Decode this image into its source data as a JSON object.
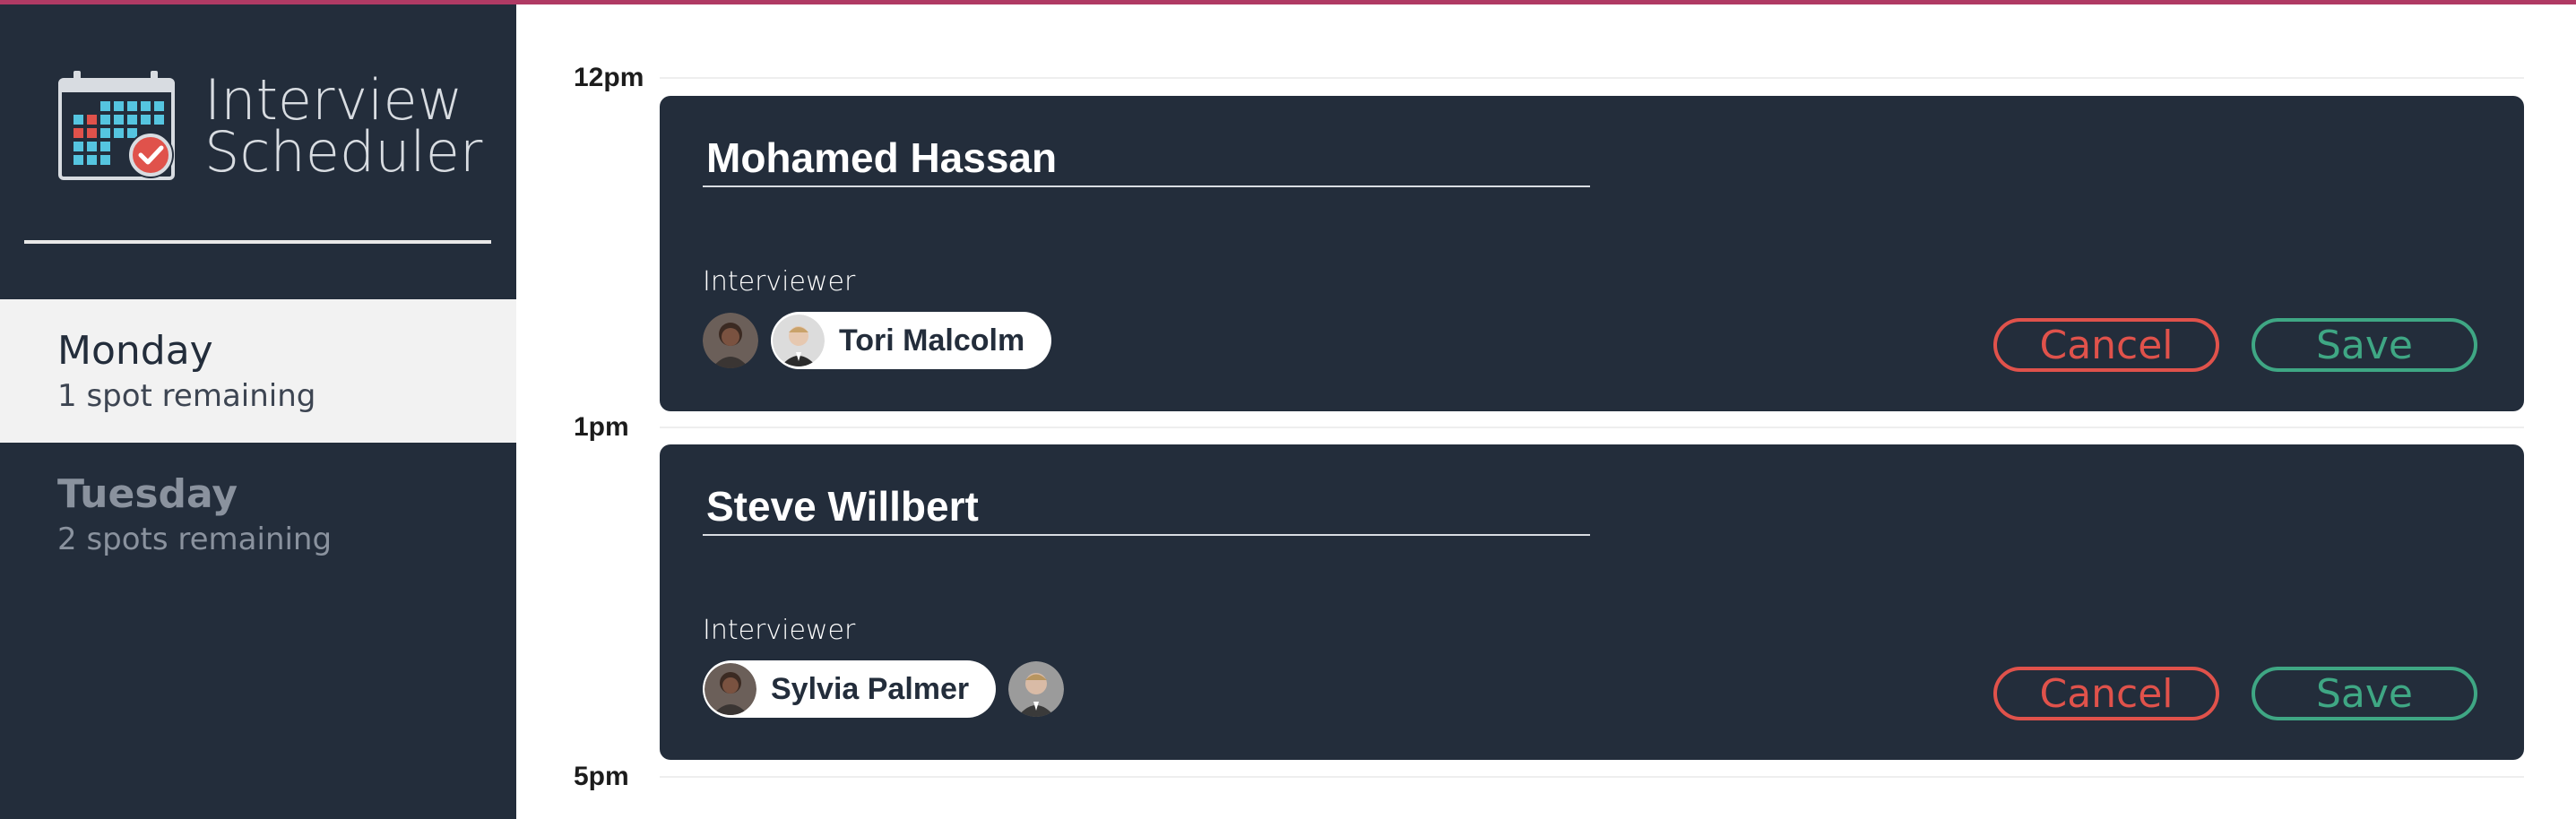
{
  "app": {
    "title_line1": "Interview",
    "title_line2": "Scheduler"
  },
  "colors": {
    "sidebar": "#232d3b",
    "accent_bar": "#b03a64",
    "cancel": "#e0524b",
    "save": "#3fa784",
    "selected_day_bg": "#f2f2f2"
  },
  "days": [
    {
      "name": "Monday",
      "spots": "1 spot remaining"
    },
    {
      "name": "Tuesday",
      "spots": "2 spots remaining"
    }
  ],
  "times": [
    "12pm",
    "1pm",
    "5pm"
  ],
  "appointments": [
    {
      "student": "Mohamed Hassan",
      "interviewer_label": "Interviewer",
      "selected_interviewer": "Tori Malcolm",
      "cancel_label": "Cancel",
      "save_label": "Save"
    },
    {
      "student": "Steve Willbert",
      "interviewer_label": "Interviewer",
      "selected_interviewer": "Sylvia Palmer",
      "cancel_label": "Cancel",
      "save_label": "Save"
    }
  ]
}
